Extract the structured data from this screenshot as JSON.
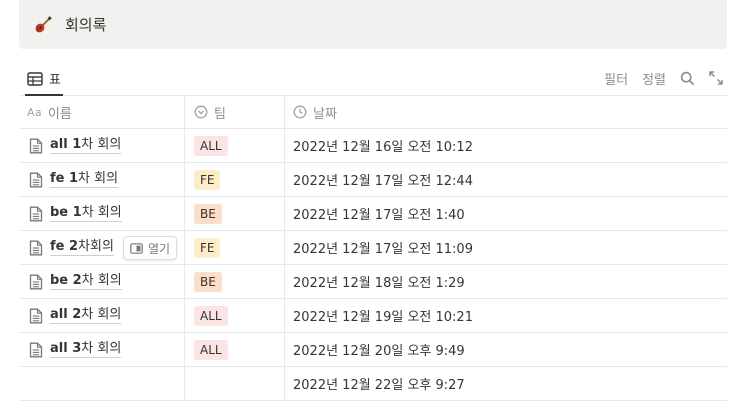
{
  "database": {
    "title": "회의록",
    "icon": "guitar-icon"
  },
  "view": {
    "tab_label": "표",
    "filter_label": "필터",
    "sort_label": "정렬"
  },
  "columns": {
    "name": "이름",
    "name_prefix": "Aa",
    "team": "팀",
    "date": "날짜"
  },
  "open_button": "열기",
  "tag_colors": {
    "ALL": "#fbe4e4",
    "FE": "#fdecc8",
    "BE": "#fadec9"
  },
  "rows": [
    {
      "title_bold": "all 1",
      "title_rest": "차 회의",
      "team": "ALL",
      "date": "2022년 12월 16일 오전 10:12"
    },
    {
      "title_bold": "fe 1",
      "title_rest": "차 회의",
      "team": "FE",
      "date": "2022년 12월 17일 오전 12:44"
    },
    {
      "title_bold": "be 1",
      "title_rest": "차 회의",
      "team": "BE",
      "date": "2022년 12월 17일 오전 1:40"
    },
    {
      "title_bold": "fe 2",
      "title_rest": "차회의",
      "team": "FE",
      "date": "2022년 12월 17일 오전 11:09"
    },
    {
      "title_bold": "be 2",
      "title_rest": "차 회의",
      "team": "BE",
      "date": "2022년 12월 18일 오전 1:29"
    },
    {
      "title_bold": "all 2",
      "title_rest": "차 회의",
      "team": "ALL",
      "date": "2022년 12월 19일 오전 10:21"
    },
    {
      "title_bold": "all 3",
      "title_rest": "차 회의",
      "team": "ALL",
      "date": "2022년 12월 20일 오후 9:49"
    },
    {
      "title_bold": "",
      "title_rest": "",
      "team": "",
      "date": "2022년 12월 22일 오후 9:27"
    }
  ]
}
